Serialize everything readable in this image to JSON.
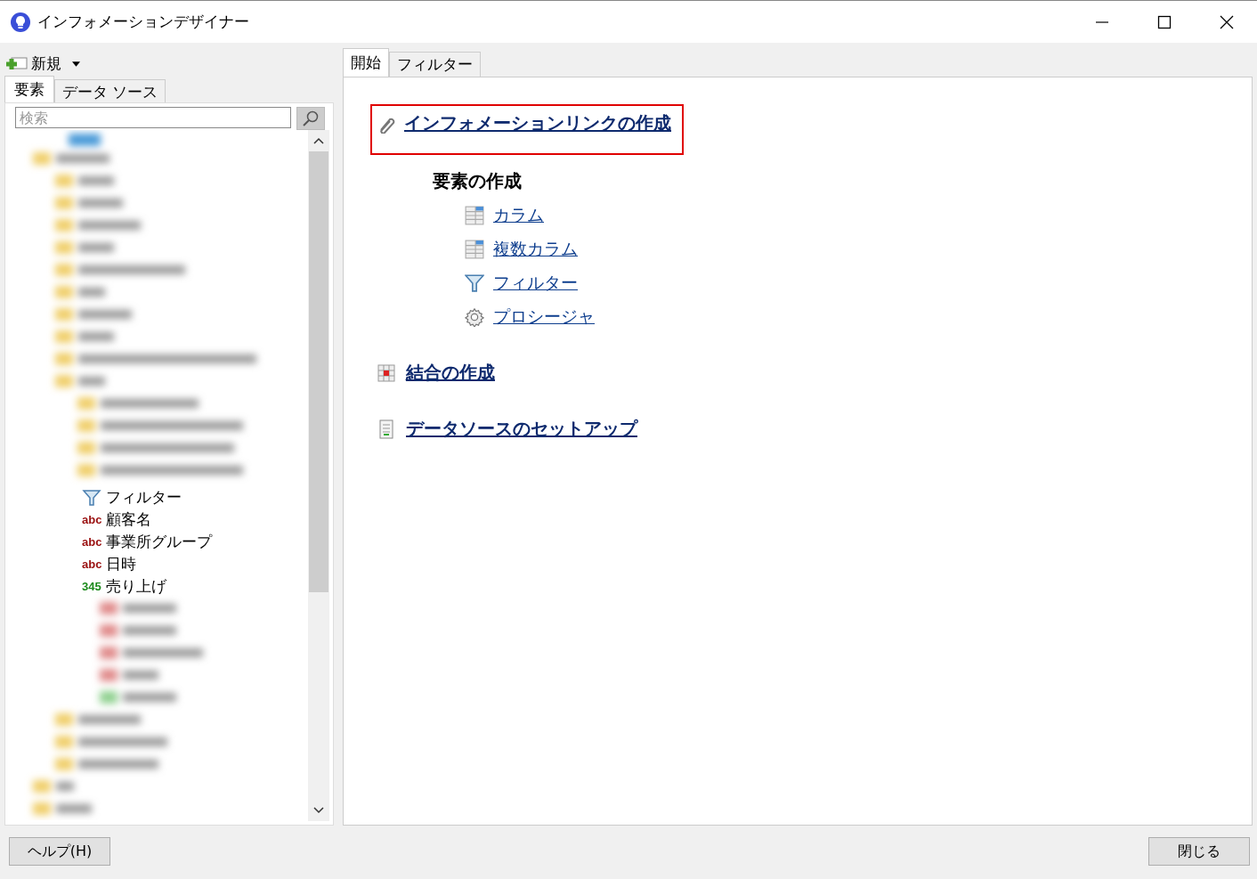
{
  "window": {
    "title": "インフォメーションデザイナー"
  },
  "left": {
    "new_button": "新規",
    "tabs": [
      {
        "label": "要素",
        "selected": true
      },
      {
        "label": "データ ソース",
        "selected": false
      }
    ],
    "search": {
      "placeholder": "検索"
    },
    "tree_items": [
      {
        "kind": "filter",
        "label": "フィルター"
      },
      {
        "kind": "text",
        "type_label": "abc",
        "label": "顧客名"
      },
      {
        "kind": "text",
        "type_label": "abc",
        "label": "事業所グループ"
      },
      {
        "kind": "text",
        "type_label": "abc",
        "label": "日時"
      },
      {
        "kind": "number",
        "type_label": "345",
        "label": "売り上げ"
      }
    ]
  },
  "right": {
    "tabs": [
      {
        "label": "開始",
        "selected": true
      },
      {
        "label": "フィルター",
        "selected": false
      }
    ],
    "main_link": {
      "label": "インフォメーションリンクの作成",
      "highlighted": true
    },
    "section_title": "要素の作成",
    "element_links": [
      {
        "kind": "column",
        "label": "カラム"
      },
      {
        "kind": "column",
        "label": "複数カラム"
      },
      {
        "kind": "filter",
        "label": "フィルター"
      },
      {
        "kind": "procedure",
        "label": "プロシージャ"
      }
    ],
    "join_link": "結合の作成",
    "datasource_link": "データソースのセットアップ"
  },
  "buttons": {
    "help": "ヘルプ(H)",
    "close": "閉じる"
  }
}
